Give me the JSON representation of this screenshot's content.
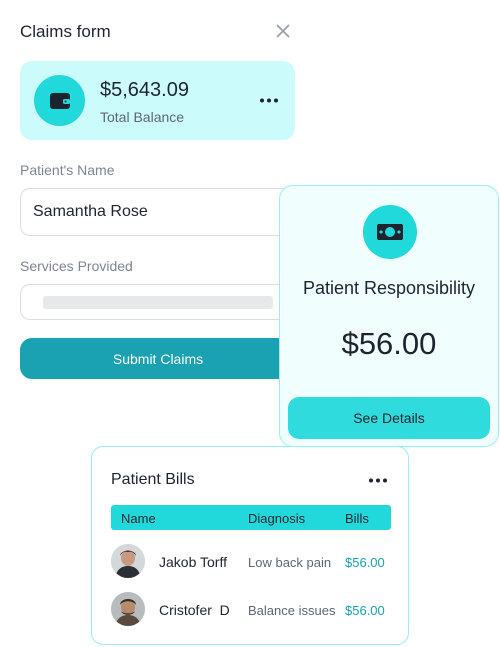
{
  "form": {
    "title": "Claims form",
    "close_icon": "close-icon"
  },
  "balance": {
    "amount": "$5,643.09",
    "label": "Total Balance",
    "icon": "wallet-icon",
    "menu_icon": "more-horizontal-icon"
  },
  "patient_name": {
    "label": "Patient's Name",
    "value": "Samantha Rose"
  },
  "services": {
    "label": "Services Provided"
  },
  "submit": {
    "label": "Submit Claims"
  },
  "responsibility": {
    "icon": "money-bill-icon",
    "title": "Patient Responsibility",
    "amount": "$56.00",
    "button_label": "See Details"
  },
  "bills": {
    "title": "Patient Bills",
    "menu_icon": "more-horizontal-icon",
    "columns": [
      "Name",
      "Diagnosis",
      "Bills"
    ],
    "rows": [
      {
        "name": "Jakob Torff",
        "diagnosis": "Low back pain",
        "amount": "$56.00"
      },
      {
        "name": "Cristofer  D",
        "diagnosis": "Balance issues",
        "amount": "$56.00"
      }
    ]
  },
  "colors": {
    "accent": "#21d8da",
    "card_bg": "#ccfbfb",
    "primary_button": "#1aa2b3",
    "link": "#1aa2b3"
  }
}
